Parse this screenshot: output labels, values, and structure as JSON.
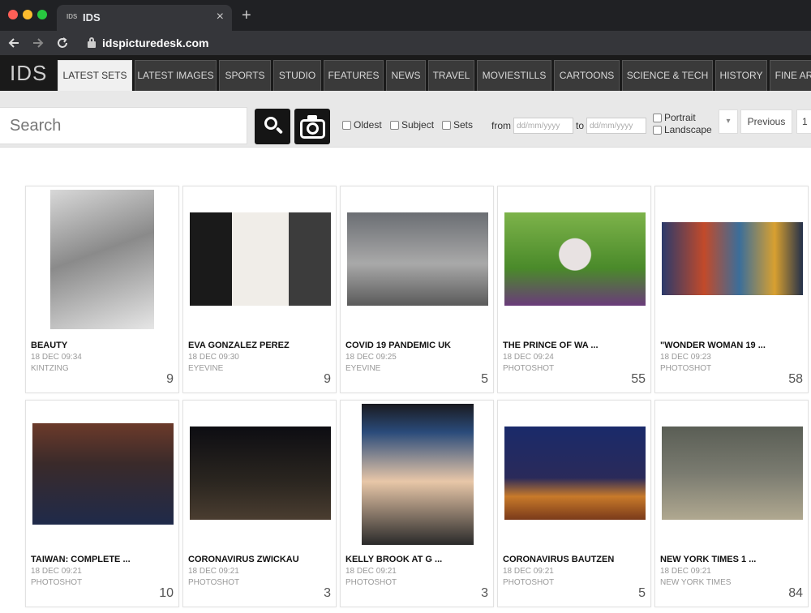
{
  "browser": {
    "tab_favicon": "IDS",
    "tab_title": "IDS",
    "close": "×",
    "new_tab": "+",
    "url": "idspicturedesk.com",
    "nav_icons": [
      "back-arrow-icon",
      "forward-arrow-icon",
      "reload-icon",
      "lock-icon"
    ]
  },
  "site": {
    "logo": "IDS",
    "tabs": [
      {
        "label": "LATEST SETS",
        "active": true
      },
      {
        "label": "LATEST IMAGES"
      },
      {
        "label": "SPORTS"
      },
      {
        "label": "STUDIO"
      },
      {
        "label": "FEATURES"
      },
      {
        "label": "NEWS"
      },
      {
        "label": "TRAVEL"
      },
      {
        "label": "MOVIESTILLS"
      },
      {
        "label": "CARTOONS"
      },
      {
        "label": "SCIENCE & TECH"
      },
      {
        "label": "HISTORY"
      },
      {
        "label": "FINE AR"
      }
    ]
  },
  "search": {
    "placeholder": "Search",
    "filters": [
      "Oldest",
      "Subject",
      "Sets"
    ],
    "from_label": "from",
    "to_label": "to",
    "date_placeholder": "dd/mm/yyyy",
    "orientation": [
      "Portrait",
      "Landscape"
    ],
    "dropdown": "▾",
    "previous": "Previous",
    "page": "1"
  },
  "cards": [
    {
      "title": "BEAUTY",
      "date": "18 DEC 09:34",
      "source": "KINTZING",
      "count": "9"
    },
    {
      "title": "EVA GONZALEZ PEREZ",
      "date": "18 DEC 09:30",
      "source": "EYEVINE",
      "count": "9"
    },
    {
      "title": "COVID 19 PANDEMIC UK",
      "date": "18 DEC 09:25",
      "source": "EYEVINE",
      "count": "5"
    },
    {
      "title": "THE PRINCE OF WA ...",
      "date": "18 DEC 09:24",
      "source": "PHOTOSHOT",
      "count": "55"
    },
    {
      "title": "\"WONDER WOMAN 19 ...",
      "date": "18 DEC 09:23",
      "source": "PHOTOSHOT",
      "count": "58"
    },
    {
      "title": "TAIWAN: COMPLETE ...",
      "date": "18 DEC 09:21",
      "source": "PHOTOSHOT",
      "count": "10"
    },
    {
      "title": "CORONAVIRUS ZWICKAU",
      "date": "18 DEC 09:21",
      "source": "PHOTOSHOT",
      "count": "3"
    },
    {
      "title": "KELLY BROOK AT G ...",
      "date": "18 DEC 09:21",
      "source": "PHOTOSHOT",
      "count": "3"
    },
    {
      "title": "CORONAVIRUS BAUTZEN",
      "date": "18 DEC 09:21",
      "source": "PHOTOSHOT",
      "count": "5"
    },
    {
      "title": "NEW YORK TIMES 1 ...",
      "date": "18 DEC 09:21",
      "source": "NEW YORK TIMES",
      "count": "84"
    }
  ]
}
